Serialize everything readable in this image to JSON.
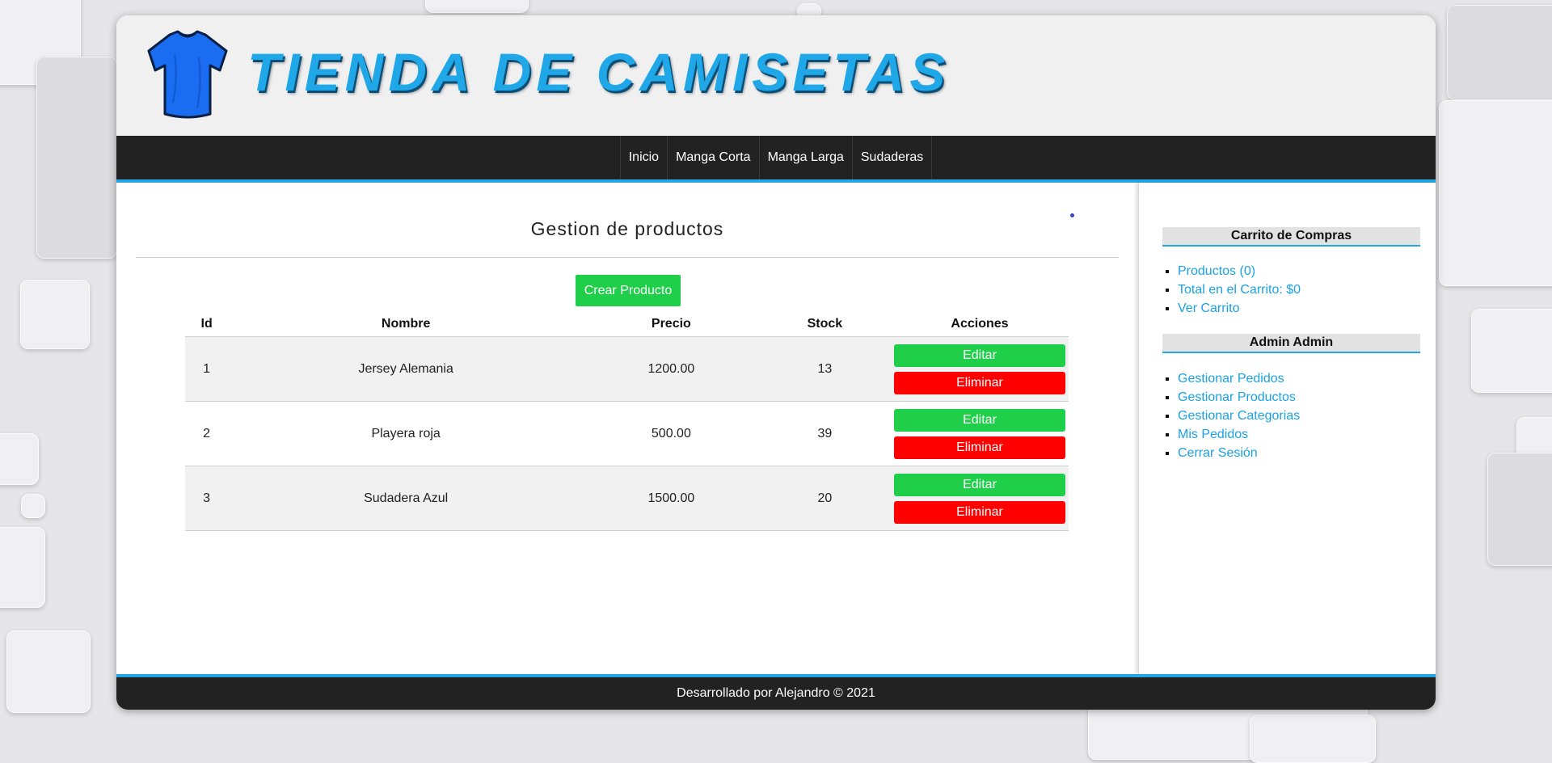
{
  "header": {
    "title": "TIENDA DE CAMISETAS"
  },
  "nav": {
    "items": [
      "Inicio",
      "Manga Corta",
      "Manga Larga",
      "Sudaderas"
    ]
  },
  "main": {
    "title": "Gestion de productos",
    "create_label": "Crear Producto",
    "columns": [
      "Id",
      "Nombre",
      "Precio",
      "Stock",
      "Acciones"
    ],
    "rows": [
      {
        "id": "1",
        "nombre": "Jersey Alemania",
        "precio": "1200.00",
        "stock": "13"
      },
      {
        "id": "2",
        "nombre": "Playera roja",
        "precio": "500.00",
        "stock": "39"
      },
      {
        "id": "3",
        "nombre": "Sudadera Azul",
        "precio": "1500.00",
        "stock": "20"
      }
    ],
    "edit_label": "Editar",
    "delete_label": "Eliminar"
  },
  "sidebar": {
    "cart_heading": "Carrito de Compras",
    "cart_items": [
      "Productos (0)",
      "Total en el Carrito: $0",
      "Ver Carrito"
    ],
    "admin_heading": "Admin Admin",
    "admin_items": [
      "Gestionar Pedidos",
      "Gestionar Productos",
      "Gestionar Categorias",
      "Mis Pedidos",
      "Cerrar Sesión"
    ]
  },
  "footer": {
    "text": "Desarrollado por Alejandro © 2021"
  },
  "colors": {
    "accent": "#23a6e3",
    "success": "#1fcf4a",
    "danger": "#ff0000",
    "dark": "#222222"
  },
  "icons": {
    "logo": "tshirt-icon"
  }
}
